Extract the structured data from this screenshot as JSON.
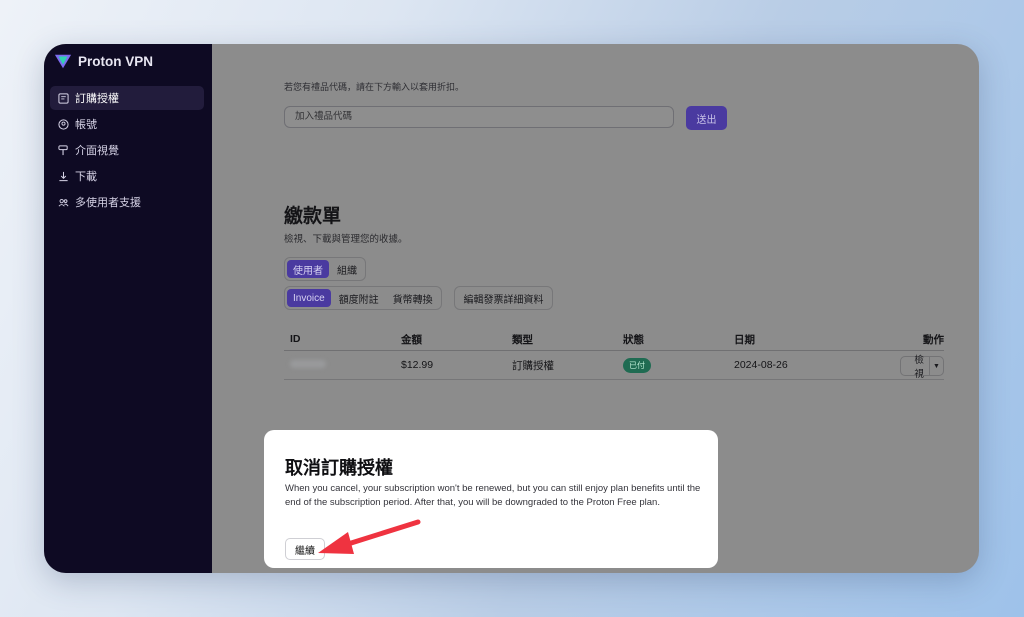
{
  "app": {
    "name": "Proton VPN"
  },
  "sidebar": {
    "items": [
      {
        "label": "訂購授權",
        "icon": "subscription-icon",
        "active": true
      },
      {
        "label": "帳號",
        "icon": "account-icon",
        "active": false
      },
      {
        "label": "介面視覺",
        "icon": "paint-roller-icon",
        "active": false
      },
      {
        "label": "下載",
        "icon": "download-icon",
        "active": false
      },
      {
        "label": "多使用者支援",
        "icon": "users-icon",
        "active": false
      }
    ]
  },
  "gift": {
    "hint": "若您有禮品代碼，請在下方輸入以套用折扣。",
    "placeholder": "加入禮品代碼",
    "submit": "送出"
  },
  "invoices": {
    "title": "繳款單",
    "subtitle": "檢視、下載與管理您的收據。",
    "owner_tabs": [
      "使用者",
      "組織"
    ],
    "type_tabs": [
      "Invoice",
      "額度附註",
      "貨幣轉換"
    ],
    "edit_button": "編輯發票詳細資料",
    "columns": [
      "ID",
      "金額",
      "類型",
      "狀態",
      "日期",
      "動作"
    ],
    "rows": [
      {
        "id": "",
        "amount": "$12.99",
        "type": "訂購授權",
        "status": "已付",
        "date": "2024-08-26",
        "action": "檢視"
      }
    ]
  },
  "modal": {
    "title": "取消訂購授權",
    "body": "When you cancel, your subscription won't be renewed, but you can still enjoy plan benefits until the end of the subscription period. After that, you will be downgraded to the Proton Free plan.",
    "continue": "繼續"
  },
  "colors": {
    "sidebar_bg": "#0e0a23",
    "accent": "#6d4aff",
    "paid_badge": "#1f6b52",
    "annotation_arrow": "#ef3340"
  }
}
